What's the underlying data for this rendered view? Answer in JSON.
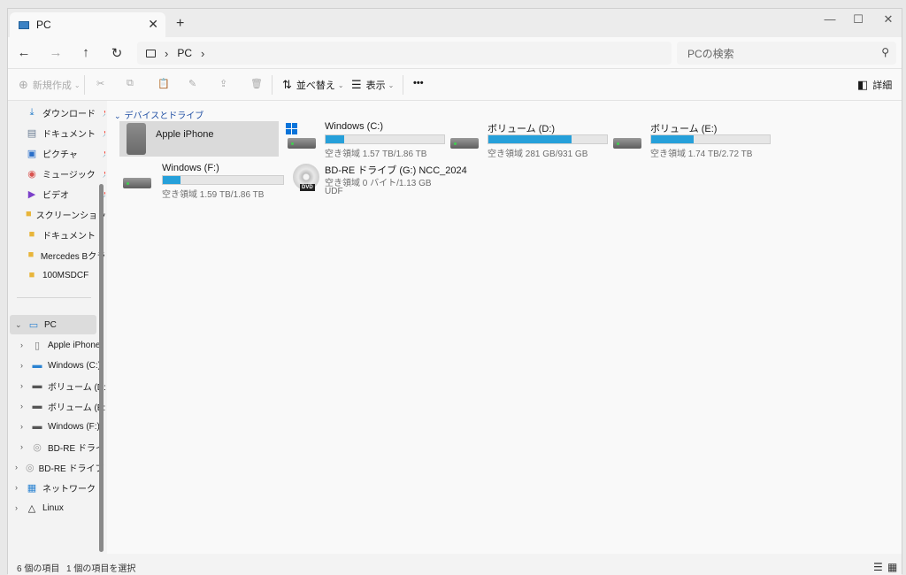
{
  "window": {
    "tab_title": "PC",
    "new_tab": "+",
    "minimize": "—",
    "maximize": "☐",
    "close": "✕"
  },
  "nav": {
    "back": "←",
    "forward": "→",
    "up": "↑",
    "refresh": "↻",
    "breadcrumb": "PC",
    "search_placeholder": "PCの検索"
  },
  "commands": {
    "new": "新規作成",
    "sort": "並べ替え",
    "view": "表示",
    "more": "•••",
    "details": "詳細"
  },
  "sidebar": {
    "quick": [
      {
        "label": "ダウンロード",
        "icon": "download-icon",
        "pinned": true
      },
      {
        "label": "ドキュメント",
        "icon": "document-icon",
        "pinned": true
      },
      {
        "label": "ピクチャ",
        "icon": "pictures-icon",
        "pinned": true
      },
      {
        "label": "ミュージック",
        "icon": "music-icon",
        "pinned": true
      },
      {
        "label": "ビデオ",
        "icon": "video-icon",
        "pinned": true
      },
      {
        "label": "スクリーンショット",
        "icon": "folder-icon",
        "pinned": false
      },
      {
        "label": "ドキュメント",
        "icon": "folder-icon",
        "pinned": false
      },
      {
        "label": "Mercedes Bクラス",
        "icon": "folder-icon",
        "pinned": false
      },
      {
        "label": "100MSDCF",
        "icon": "folder-icon",
        "pinned": false
      }
    ],
    "pc_label": "PC",
    "pc_children": [
      {
        "label": "Apple iPhone",
        "icon": "phone-icon"
      },
      {
        "label": "Windows (C:)",
        "icon": "windows-drive-icon"
      },
      {
        "label": "ボリューム (D:)",
        "icon": "drive-icon"
      },
      {
        "label": "ボリューム (E:)",
        "icon": "drive-icon"
      },
      {
        "label": "Windows (F:)",
        "icon": "drive-icon"
      },
      {
        "label": "BD-RE ドライブ (",
        "icon": "disc-icon"
      }
    ],
    "root_items": [
      {
        "label": "BD-RE ドライブ (G",
        "icon": "disc-icon"
      },
      {
        "label": "ネットワーク",
        "icon": "network-icon"
      },
      {
        "label": "Linux",
        "icon": "linux-icon"
      }
    ]
  },
  "main": {
    "group_title": "デバイスとドライブ",
    "devices": [
      {
        "name": "Apple iPhone"
      },
      {
        "name": "Windows (C:)",
        "free": "空き領域 1.57 TB/1.86 TB",
        "used_fraction": 0.16
      },
      {
        "name": "ボリューム (D:)",
        "free": "空き領域 281 GB/931 GB",
        "used_fraction": 0.7
      },
      {
        "name": "ボリューム (E:)",
        "free": "空き領域 1.74 TB/2.72 TB",
        "used_fraction": 0.36
      },
      {
        "name": "Windows (F:)",
        "free": "空き領域 1.59 TB/1.86 TB",
        "used_fraction": 0.15
      },
      {
        "name": "BD-RE ドライブ (G:) NCC_2024",
        "free": "空き領域 0 バイト/1.13 GB",
        "fs": "UDF"
      }
    ]
  },
  "status": {
    "item_count": "6 個の項目",
    "selected": "1 個の項目を選択"
  },
  "colors": {
    "accent": "#26a0da",
    "link": "#1f4ea3"
  }
}
